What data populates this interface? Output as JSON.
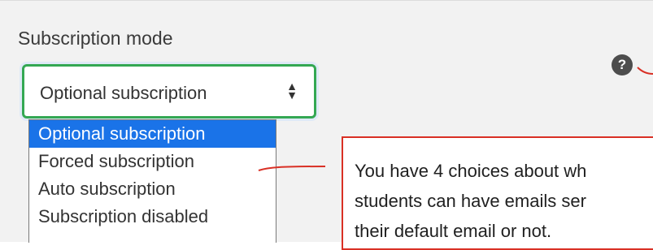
{
  "field": {
    "label": "Subscription mode",
    "help_icon": "question-mark-icon",
    "selected_value": "Optional subscription",
    "arrows_icon": "up-down-chevron-icon"
  },
  "dropdown": {
    "options": [
      {
        "label": "Optional subscription",
        "selected": true
      },
      {
        "label": "Forced subscription",
        "selected": false
      },
      {
        "label": "Auto subscription",
        "selected": false
      },
      {
        "label": "Subscription disabled",
        "selected": false
      }
    ]
  },
  "annotation": {
    "lines": [
      "You have 4 choices about wh",
      "students can have emails ser",
      "their default email or not."
    ],
    "color": "#d93025"
  },
  "colors": {
    "focus_border": "#34a853",
    "selected_option": "#1a73e8"
  }
}
